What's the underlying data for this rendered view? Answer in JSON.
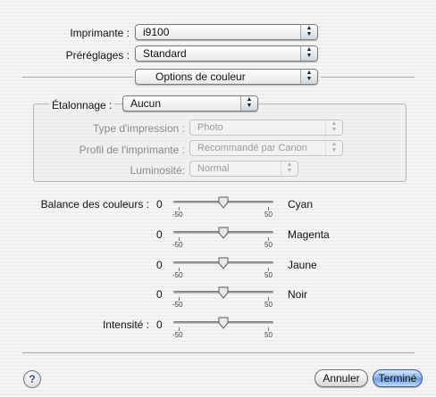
{
  "printer": {
    "label": "Imprimante :",
    "value": "i9100"
  },
  "presets": {
    "label": "Préréglages :",
    "value": "Standard"
  },
  "panel_select": {
    "value": "Options de couleur"
  },
  "calibration": {
    "label": "Étalonnage :",
    "value": "Aucun",
    "print_type": {
      "label": "Type d'impression :",
      "value": "Photo"
    },
    "printer_profile": {
      "label": "Profil de l'imprimante :",
      "value": "Recommandé par Canon"
    },
    "brightness": {
      "label": "Luminosité:",
      "value": "Normal"
    }
  },
  "color_balance": {
    "label": "Balance des couleurs :",
    "sliders": [
      {
        "name": "Cyan",
        "value": "0",
        "min_label": "-50",
        "max_label": "50",
        "level": 0.5
      },
      {
        "name": "Magenta",
        "value": "0",
        "min_label": "-50",
        "max_label": "50",
        "level": 0.5
      },
      {
        "name": "Jaune",
        "value": "0",
        "min_label": "-50",
        "max_label": "50",
        "level": 0.5
      },
      {
        "name": "Noir",
        "value": "0",
        "min_label": "-50",
        "max_label": "50",
        "level": 0.5
      }
    ]
  },
  "intensity": {
    "label": "Intensité :",
    "value": "0",
    "min_label": "-50",
    "max_label": "50",
    "level": 0.5
  },
  "footer": {
    "help_glyph": "?",
    "help_icon": "help-icon",
    "cancel_label": "Annuler",
    "ok_label": "Terminé"
  }
}
